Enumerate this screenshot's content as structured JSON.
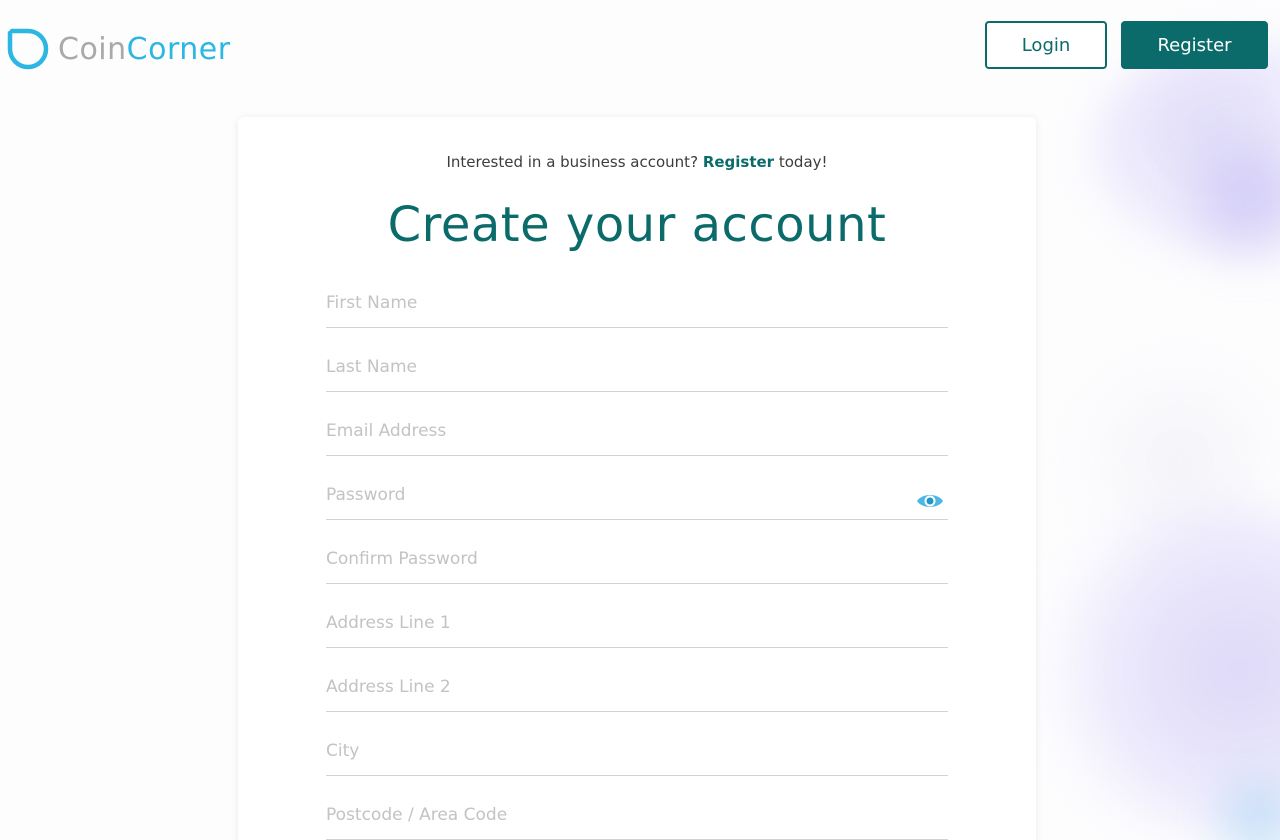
{
  "brand": {
    "name_part1": "Coin",
    "name_part2": "Corner",
    "colors": {
      "primary": "#0b6b6a",
      "logo_grey": "#a9a9ab",
      "logo_blue": "#2bb7e2",
      "accent_purple": "#c4bcf4"
    }
  },
  "header": {
    "login_label": "Login",
    "register_label": "Register"
  },
  "card": {
    "business_prefix": "Interested in a business account?",
    "business_link": "Register",
    "business_suffix": "today!",
    "title": "Create your account",
    "fields": [
      {
        "placeholder": "First Name",
        "value": ""
      },
      {
        "placeholder": "Last Name",
        "value": ""
      },
      {
        "placeholder": "Email Address",
        "value": ""
      },
      {
        "placeholder": "Password",
        "value": "",
        "icon": "eye-icon"
      },
      {
        "placeholder": "Confirm Password",
        "value": ""
      },
      {
        "placeholder": "Address Line 1",
        "value": ""
      },
      {
        "placeholder": "Address Line 2",
        "value": ""
      },
      {
        "placeholder": "City",
        "value": ""
      },
      {
        "placeholder": "Postcode / Area Code",
        "value": ""
      }
    ]
  }
}
